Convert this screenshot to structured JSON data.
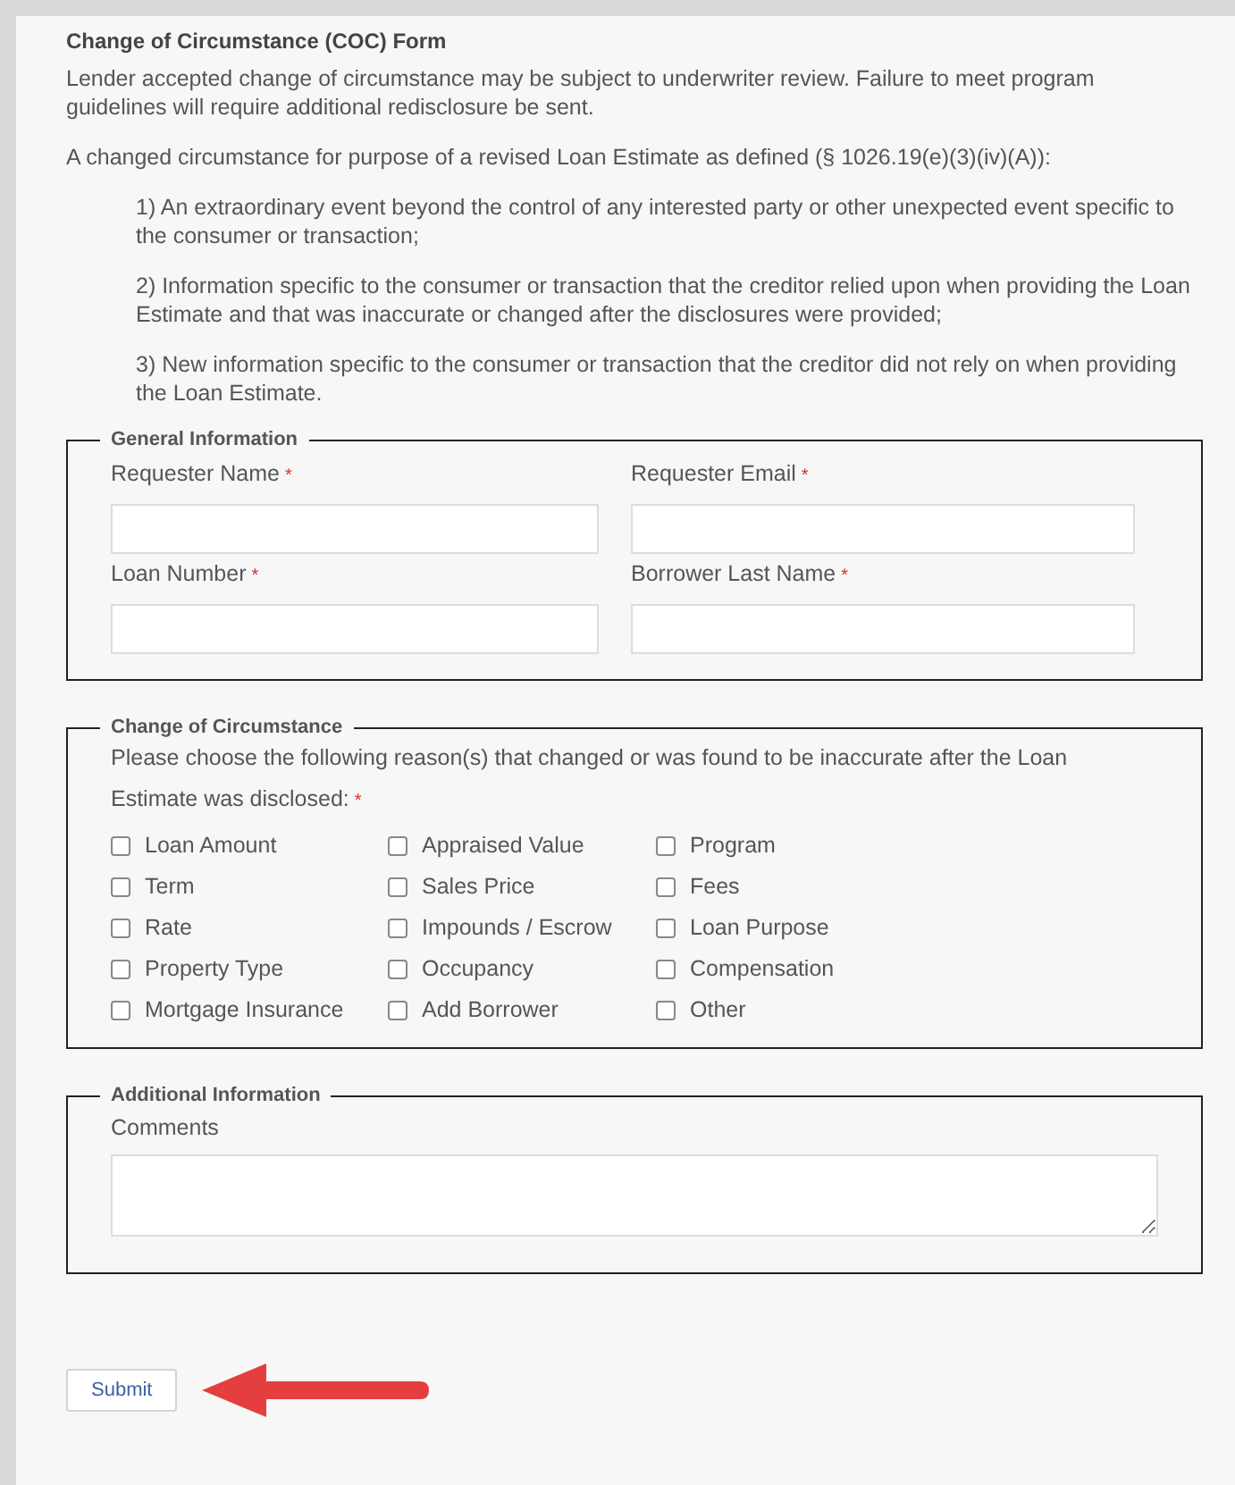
{
  "title": "Change of Circumstance (COC) Form",
  "intro": "Lender accepted change of circumstance may be subject to underwriter review. Failure to meet program guidelines will require additional redisclosure be sent.",
  "definition": "A changed circumstance for purpose of a revised Loan Estimate as defined (§ 1026.19(e)(3)(iv)(A)):",
  "conditions": [
    "1) An extraordinary event beyond the control of any interested party or other unexpected event specific to the consumer or transaction;",
    "2) Information specific to the consumer or transaction that the creditor relied upon when providing the Loan Estimate and that was inaccurate or changed after the disclosures were provided;",
    "3) New information specific to the consumer or transaction that the creditor did not rely on when providing the Loan Estimate."
  ],
  "general_information": {
    "legend": "General Information",
    "fields": [
      {
        "label": "Requester Name",
        "required_mark": "*"
      },
      {
        "label": "Requester Email",
        "required_mark": "*"
      },
      {
        "label": "Loan Number",
        "required_mark": "*"
      },
      {
        "label": "Borrower Last Name",
        "required_mark": "*"
      }
    ]
  },
  "change_of_circumstance": {
    "legend": "Change of Circumstance",
    "prompt": "Please choose the following reason(s) that changed or was found to be inaccurate after the Loan Estimate was disclosed:",
    "required_mark": "*",
    "options": [
      {
        "label": "Loan Amount",
        "checked": false
      },
      {
        "label": "Appraised Value",
        "checked": false
      },
      {
        "label": "Program",
        "checked": false
      },
      {
        "label": "Term",
        "checked": false
      },
      {
        "label": "Sales Price",
        "checked": false
      },
      {
        "label": "Fees",
        "checked": false
      },
      {
        "label": "Rate",
        "checked": false
      },
      {
        "label": "Impounds / Escrow",
        "checked": false
      },
      {
        "label": "Loan Purpose",
        "checked": false
      },
      {
        "label": "Property Type",
        "checked": false
      },
      {
        "label": "Occupancy",
        "checked": false
      },
      {
        "label": "Compensation",
        "checked": false
      },
      {
        "label": "Mortgage Insurance",
        "checked": false
      },
      {
        "label": "Add Borrower",
        "checked": false
      },
      {
        "label": "Other",
        "checked": false
      }
    ]
  },
  "additional_information": {
    "legend": "Additional Information",
    "fields": [
      {
        "label": "Comments"
      }
    ]
  },
  "submit_button": "Submit"
}
